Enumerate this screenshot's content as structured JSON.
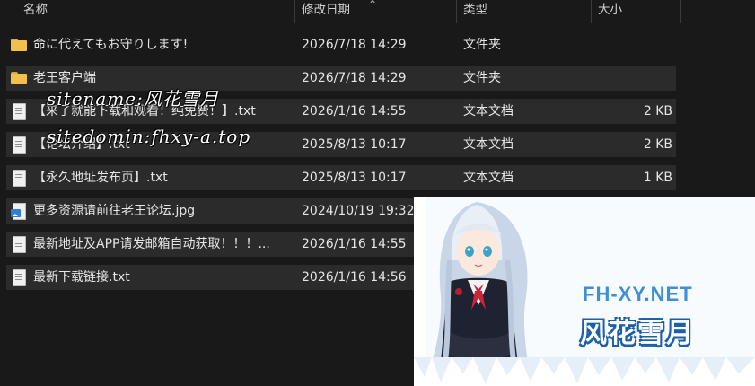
{
  "columns": {
    "name": "名称",
    "date": "修改日期",
    "type": "类型",
    "size": "大小"
  },
  "files": [
    {
      "icon": "folder-icon",
      "name": "命に代えてもお守りします!",
      "date": "2026/7/18 14:29",
      "type": "文件夹",
      "size": ""
    },
    {
      "icon": "folder-icon",
      "name": "老王客户端",
      "date": "2026/7/18 14:29",
      "type": "文件夹",
      "size": ""
    },
    {
      "icon": "text-file-icon",
      "name": "【来了就能下载和观看！纯免费！】.txt",
      "date": "2026/1/16 14:55",
      "type": "文本文档",
      "size": "2 KB"
    },
    {
      "icon": "text-file-icon",
      "name": "【论坛介绍】.txt",
      "date": "2025/8/13 10:17",
      "type": "文本文档",
      "size": "2 KB"
    },
    {
      "icon": "text-file-icon",
      "name": "【永久地址发布页】.txt",
      "date": "2025/8/13 10:17",
      "type": "文本文档",
      "size": "1 KB"
    },
    {
      "icon": "image-file-icon",
      "name": "更多资源请前往老王论坛.jpg",
      "date": "2024/10/19 19:32",
      "type": "",
      "size": ""
    },
    {
      "icon": "text-file-icon",
      "name": "最新地址及APP请发邮箱自动获取！！！...",
      "date": "2026/1/16 14:55",
      "type": "",
      "size": ""
    },
    {
      "icon": "text-file-icon",
      "name": "最新下载链接.txt",
      "date": "2026/1/16 14:56",
      "type": "",
      "size": ""
    }
  ],
  "watermark": {
    "line1": "sitename:风花雪月",
    "line2": "sitedomin:fhxy-a.top"
  },
  "ad": {
    "title": "FH-XY.NET",
    "subtitle": "风花雪月"
  },
  "colors": {
    "background": "#191919",
    "row_alt": "#2b2b2b",
    "folder": "#f3c14b",
    "ad_blue": "#3e8fd8"
  }
}
